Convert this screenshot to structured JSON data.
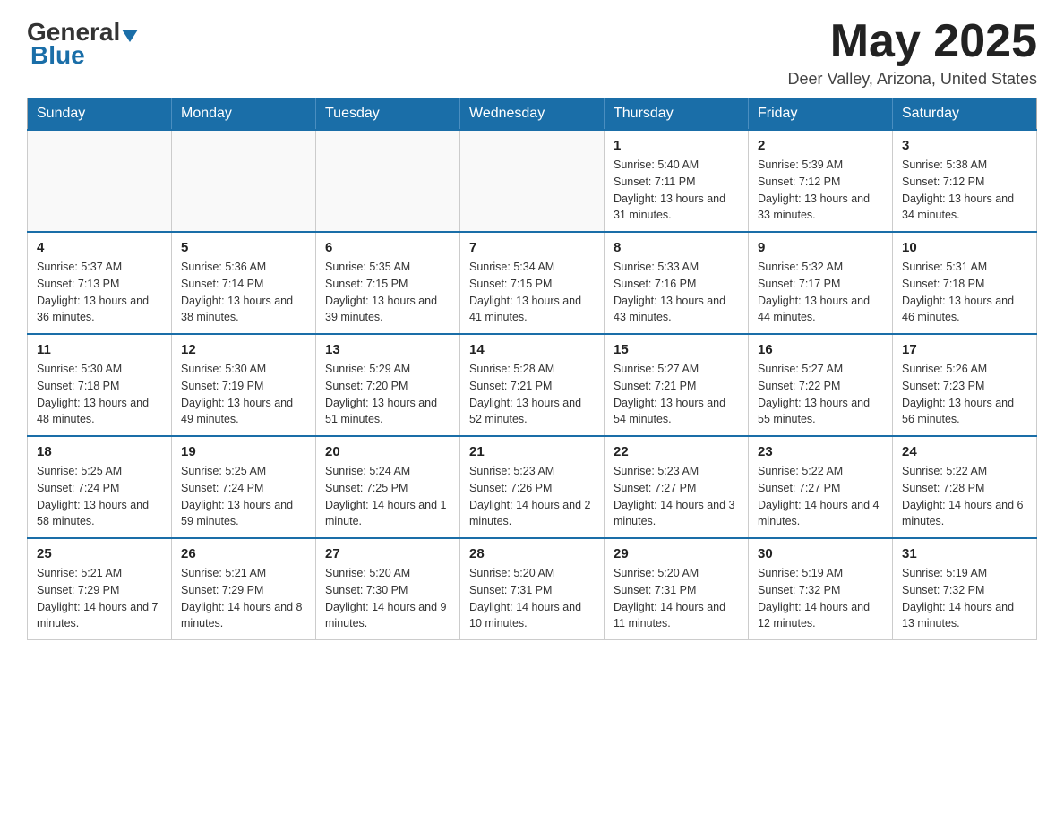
{
  "header": {
    "logo_general": "General",
    "logo_blue": "Blue",
    "month_year": "May 2025",
    "location": "Deer Valley, Arizona, United States"
  },
  "days_of_week": [
    "Sunday",
    "Monday",
    "Tuesday",
    "Wednesday",
    "Thursday",
    "Friday",
    "Saturday"
  ],
  "weeks": [
    [
      {
        "day": "",
        "info": ""
      },
      {
        "day": "",
        "info": ""
      },
      {
        "day": "",
        "info": ""
      },
      {
        "day": "",
        "info": ""
      },
      {
        "day": "1",
        "info": "Sunrise: 5:40 AM\nSunset: 7:11 PM\nDaylight: 13 hours and 31 minutes."
      },
      {
        "day": "2",
        "info": "Sunrise: 5:39 AM\nSunset: 7:12 PM\nDaylight: 13 hours and 33 minutes."
      },
      {
        "day": "3",
        "info": "Sunrise: 5:38 AM\nSunset: 7:12 PM\nDaylight: 13 hours and 34 minutes."
      }
    ],
    [
      {
        "day": "4",
        "info": "Sunrise: 5:37 AM\nSunset: 7:13 PM\nDaylight: 13 hours and 36 minutes."
      },
      {
        "day": "5",
        "info": "Sunrise: 5:36 AM\nSunset: 7:14 PM\nDaylight: 13 hours and 38 minutes."
      },
      {
        "day": "6",
        "info": "Sunrise: 5:35 AM\nSunset: 7:15 PM\nDaylight: 13 hours and 39 minutes."
      },
      {
        "day": "7",
        "info": "Sunrise: 5:34 AM\nSunset: 7:15 PM\nDaylight: 13 hours and 41 minutes."
      },
      {
        "day": "8",
        "info": "Sunrise: 5:33 AM\nSunset: 7:16 PM\nDaylight: 13 hours and 43 minutes."
      },
      {
        "day": "9",
        "info": "Sunrise: 5:32 AM\nSunset: 7:17 PM\nDaylight: 13 hours and 44 minutes."
      },
      {
        "day": "10",
        "info": "Sunrise: 5:31 AM\nSunset: 7:18 PM\nDaylight: 13 hours and 46 minutes."
      }
    ],
    [
      {
        "day": "11",
        "info": "Sunrise: 5:30 AM\nSunset: 7:18 PM\nDaylight: 13 hours and 48 minutes."
      },
      {
        "day": "12",
        "info": "Sunrise: 5:30 AM\nSunset: 7:19 PM\nDaylight: 13 hours and 49 minutes."
      },
      {
        "day": "13",
        "info": "Sunrise: 5:29 AM\nSunset: 7:20 PM\nDaylight: 13 hours and 51 minutes."
      },
      {
        "day": "14",
        "info": "Sunrise: 5:28 AM\nSunset: 7:21 PM\nDaylight: 13 hours and 52 minutes."
      },
      {
        "day": "15",
        "info": "Sunrise: 5:27 AM\nSunset: 7:21 PM\nDaylight: 13 hours and 54 minutes."
      },
      {
        "day": "16",
        "info": "Sunrise: 5:27 AM\nSunset: 7:22 PM\nDaylight: 13 hours and 55 minutes."
      },
      {
        "day": "17",
        "info": "Sunrise: 5:26 AM\nSunset: 7:23 PM\nDaylight: 13 hours and 56 minutes."
      }
    ],
    [
      {
        "day": "18",
        "info": "Sunrise: 5:25 AM\nSunset: 7:24 PM\nDaylight: 13 hours and 58 minutes."
      },
      {
        "day": "19",
        "info": "Sunrise: 5:25 AM\nSunset: 7:24 PM\nDaylight: 13 hours and 59 minutes."
      },
      {
        "day": "20",
        "info": "Sunrise: 5:24 AM\nSunset: 7:25 PM\nDaylight: 14 hours and 1 minute."
      },
      {
        "day": "21",
        "info": "Sunrise: 5:23 AM\nSunset: 7:26 PM\nDaylight: 14 hours and 2 minutes."
      },
      {
        "day": "22",
        "info": "Sunrise: 5:23 AM\nSunset: 7:27 PM\nDaylight: 14 hours and 3 minutes."
      },
      {
        "day": "23",
        "info": "Sunrise: 5:22 AM\nSunset: 7:27 PM\nDaylight: 14 hours and 4 minutes."
      },
      {
        "day": "24",
        "info": "Sunrise: 5:22 AM\nSunset: 7:28 PM\nDaylight: 14 hours and 6 minutes."
      }
    ],
    [
      {
        "day": "25",
        "info": "Sunrise: 5:21 AM\nSunset: 7:29 PM\nDaylight: 14 hours and 7 minutes."
      },
      {
        "day": "26",
        "info": "Sunrise: 5:21 AM\nSunset: 7:29 PM\nDaylight: 14 hours and 8 minutes."
      },
      {
        "day": "27",
        "info": "Sunrise: 5:20 AM\nSunset: 7:30 PM\nDaylight: 14 hours and 9 minutes."
      },
      {
        "day": "28",
        "info": "Sunrise: 5:20 AM\nSunset: 7:31 PM\nDaylight: 14 hours and 10 minutes."
      },
      {
        "day": "29",
        "info": "Sunrise: 5:20 AM\nSunset: 7:31 PM\nDaylight: 14 hours and 11 minutes."
      },
      {
        "day": "30",
        "info": "Sunrise: 5:19 AM\nSunset: 7:32 PM\nDaylight: 14 hours and 12 minutes."
      },
      {
        "day": "31",
        "info": "Sunrise: 5:19 AM\nSunset: 7:32 PM\nDaylight: 14 hours and 13 minutes."
      }
    ]
  ]
}
